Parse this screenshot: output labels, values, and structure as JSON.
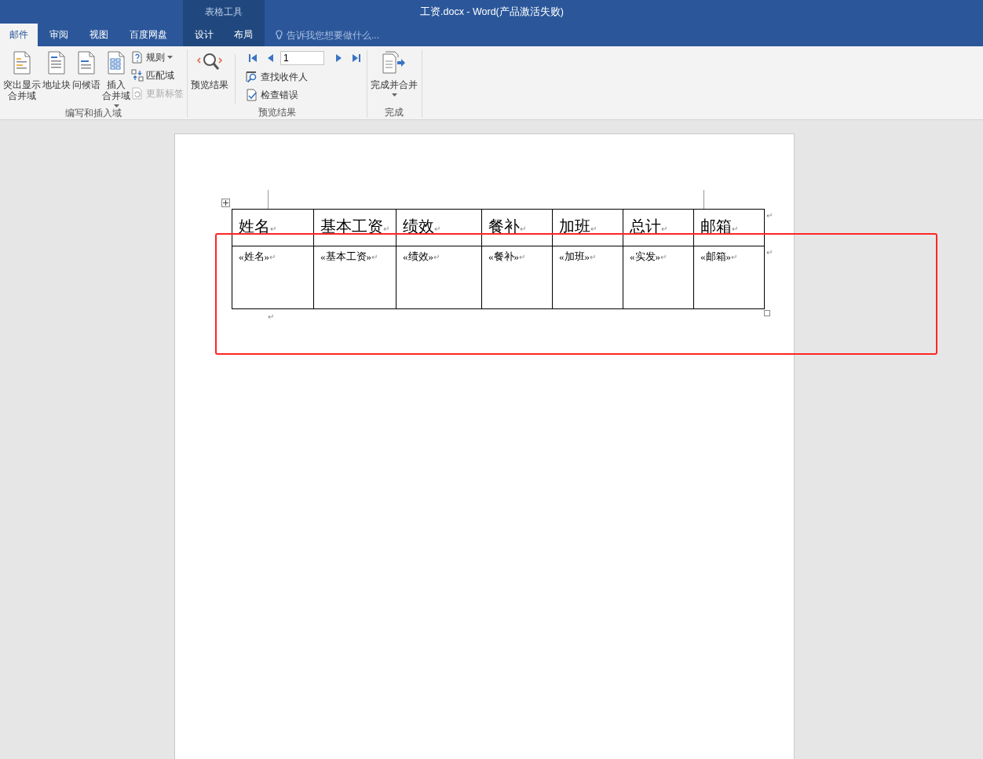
{
  "window": {
    "title": "工资.docx - Word(产品激活失败)",
    "context_group": "表格工具"
  },
  "tabs": [
    {
      "label": "邮件",
      "selected": true,
      "contextual": false
    },
    {
      "label": "审阅",
      "selected": false,
      "contextual": false
    },
    {
      "label": "视图",
      "selected": false,
      "contextual": false
    },
    {
      "label": "百度网盘",
      "selected": false,
      "contextual": false
    },
    {
      "label": "设计",
      "selected": false,
      "contextual": true
    },
    {
      "label": "布局",
      "selected": false,
      "contextual": true
    }
  ],
  "tell_me": {
    "placeholder": "告诉我您想要做什么..."
  },
  "ribbon_groups": [
    {
      "label": "编写和插入域",
      "items": [
        {
          "kind": "large",
          "label_lines": [
            "突出显示",
            "合并域"
          ],
          "dropdown": false,
          "disabled": false
        },
        {
          "kind": "large",
          "label_lines": [
            "地址块"
          ],
          "dropdown": false,
          "disabled": false
        },
        {
          "kind": "large",
          "label_lines": [
            "问候语"
          ],
          "dropdown": false,
          "disabled": false
        },
        {
          "kind": "large",
          "label_lines": [
            "插入",
            "合并域"
          ],
          "dropdown": true,
          "disabled": false
        },
        {
          "kind": "small",
          "label": "规则",
          "dropdown": true,
          "disabled": false
        },
        {
          "kind": "small",
          "label": "匹配域",
          "dropdown": false,
          "disabled": false
        },
        {
          "kind": "small",
          "label": "更新标签",
          "dropdown": false,
          "disabled": true
        }
      ]
    },
    {
      "label": "预览结果",
      "items": [
        {
          "kind": "large",
          "label_lines": [
            "预览结果"
          ],
          "dropdown": false,
          "disabled": false
        },
        {
          "kind": "nav",
          "value": "1"
        },
        {
          "kind": "small",
          "label": "查找收件人",
          "dropdown": false,
          "disabled": false
        },
        {
          "kind": "small",
          "label": "检查错误",
          "dropdown": false,
          "disabled": false
        }
      ]
    },
    {
      "label": "完成",
      "items": [
        {
          "kind": "large",
          "label_lines": [
            "完成并合并"
          ],
          "dropdown": true,
          "disabled": false
        }
      ]
    }
  ],
  "table": {
    "header": [
      {
        "text": "姓名",
        "end": "↵"
      },
      {
        "text": "基本工资",
        "end": "↵"
      },
      {
        "text": "绩效",
        "end": "↵"
      },
      {
        "text": "餐补",
        "end": "↵"
      },
      {
        "text": "加班",
        "end": "↵"
      },
      {
        "text": "总计",
        "end": "↵"
      },
      {
        "text": "邮箱",
        "end": "↵"
      }
    ],
    "rows": [
      [
        {
          "text": "«姓名»",
          "end": "↵"
        },
        {
          "text": "«基本工资»",
          "end": "↵"
        },
        {
          "text": "«绩效»",
          "end": "↵"
        },
        {
          "text": "«餐补»",
          "end": "↵"
        },
        {
          "text": "«加班»",
          "end": "↵"
        },
        {
          "text": "«实发»",
          "end": "↵"
        },
        {
          "text": "«邮箱»",
          "end": "↵"
        }
      ]
    ],
    "row_end_marks": [
      "↵",
      "↵"
    ],
    "after_mark": "↵"
  }
}
